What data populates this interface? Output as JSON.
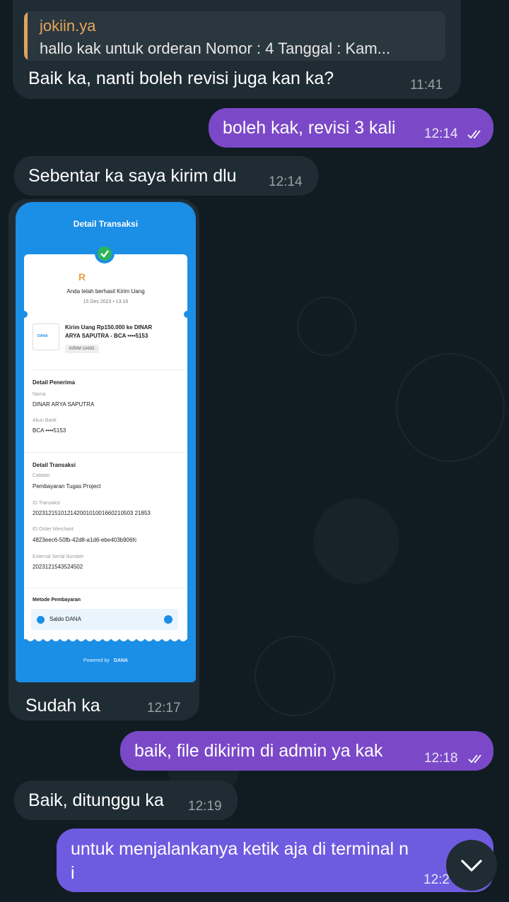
{
  "messages": {
    "m1": {
      "reply_name": "jokiin.ya",
      "reply_text": "hallo kak untuk orderan  Nomor : 4 Tanggal : Kam...",
      "text": "Baik ka, nanti boleh revisi juga kan ka?",
      "time": "11:41"
    },
    "m2": {
      "text": "boleh kak, revisi 3 kali",
      "time": "12:14"
    },
    "m3": {
      "text": "Sebentar ka saya kirim dlu",
      "time": "12:14"
    },
    "m4": {
      "caption": "Sudah ka",
      "time": "12:17"
    },
    "m5": {
      "text": "baik, file dikirim di admin ya kak",
      "time": "12:18"
    },
    "m6": {
      "text": "Baik, ditunggu ka",
      "time": "12:19"
    },
    "m7": {
      "line1": "untuk menjalankanya ketik aja di terminal n",
      "line2": "i",
      "time": "12:2"
    }
  },
  "receipt": {
    "title": "Detail Transaksi",
    "amount_partial": "R",
    "success_text": "Anda telah berhasil Kirim Uang",
    "date": "15 Des 2023 • 13:16",
    "logo_text": "DANA",
    "summary_line1": "Kirim Uang Rp150.000 ke DINAR",
    "summary_line2": "ARYA SAPUTRA - BCA ••••5153",
    "tag": "KIRIM UANG",
    "recipient_heading": "Detail Penerima",
    "name_label": "Nama",
    "name_value": "DINAR ARYA SAPUTRA",
    "bank_label": "Akun Bank",
    "bank_value": "BCA ••••5153",
    "tx_heading": "Detail Transaksi",
    "note_label": "Catatan",
    "note_value": "Pembayaran Tugas Project",
    "txid_label": "ID Transaksi",
    "txid_value": "20231215101214200101001660210503 21853",
    "order_label": "ID Order Merchant",
    "order_value": "4823eec6-50fb-42d8-a1d6-ebe403b906fc",
    "serial_label": "External Serial Number",
    "serial_value": "2023121543524502",
    "method_heading": "Metode Pembayaran",
    "method_value": "Saldo DANA",
    "powered_by": "Powered by",
    "powered_logo": "DANA"
  },
  "colors": {
    "incoming": "#1f2c34",
    "outgoing": "#7b49c8",
    "outgoing_last": "#6f5be0",
    "reply_accent": "#e0a45a"
  }
}
